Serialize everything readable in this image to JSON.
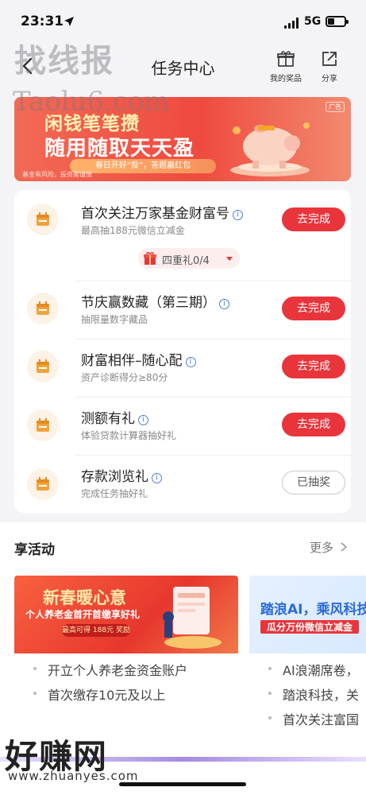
{
  "status_bar": {
    "time": "23:31",
    "network": "5G"
  },
  "header": {
    "watermark": "找线报",
    "title": "任务中心",
    "my_prizes": "我的奖品",
    "share": "分享"
  },
  "watermark_site": "Taolu6.com",
  "banner": {
    "title_line1": "闲钱笔笔攒",
    "title_line2": "随用随取天天盈",
    "subtitle": "春日开好“投”，答题赢红包",
    "risk_note": "基金有风险，投资需谨慎",
    "ad_label": "广告"
  },
  "tasks": [
    {
      "title": "首次关注万家基金财富号",
      "desc": "最高抽188元微信立减金",
      "button": "去完成",
      "status": "todo"
    },
    {
      "title": "节庆赢数藏（第三期）",
      "desc": "抽限量数字藏品",
      "button": "去完成",
      "status": "todo"
    },
    {
      "title": "财富相伴–随心配",
      "desc": "资产诊断得分≥80分",
      "button": "去完成",
      "status": "todo"
    },
    {
      "title": "测额有礼",
      "desc": "体验贷款计算器抽好礼",
      "button": "去完成",
      "status": "todo"
    },
    {
      "title": "存款浏览礼",
      "desc": "完成任务抽好礼",
      "button": "已抽奖",
      "status": "done"
    }
  ],
  "gift_pill": {
    "label": "四重礼0/4"
  },
  "activities_section": {
    "title": "享活动",
    "more": "更多"
  },
  "activities": [
    {
      "banner_title": "新春暖心意",
      "banner_sub": "个人养老金首开首缴享好礼",
      "banner_chip": "最高可得 188元 奖励",
      "items": [
        "开立个人养老金资金账户",
        "首次缴存10元及以上"
      ]
    },
    {
      "banner_title": "踏浪AI，乘风科技",
      "banner_sub": "瓜分万份微信立减金",
      "items": [
        "AI浪潮席卷，",
        "踏浪科技，关",
        "首次关注富国"
      ]
    }
  ],
  "bottom_watermark": {
    "name": "好赚网",
    "url": "www.zhuanyes.com"
  },
  "colors": {
    "accent_red": "#e8353b",
    "link_blue": "#4a7fd8",
    "icon_bg": "#fcf2e6",
    "icon_orange": "#f0a33a"
  }
}
